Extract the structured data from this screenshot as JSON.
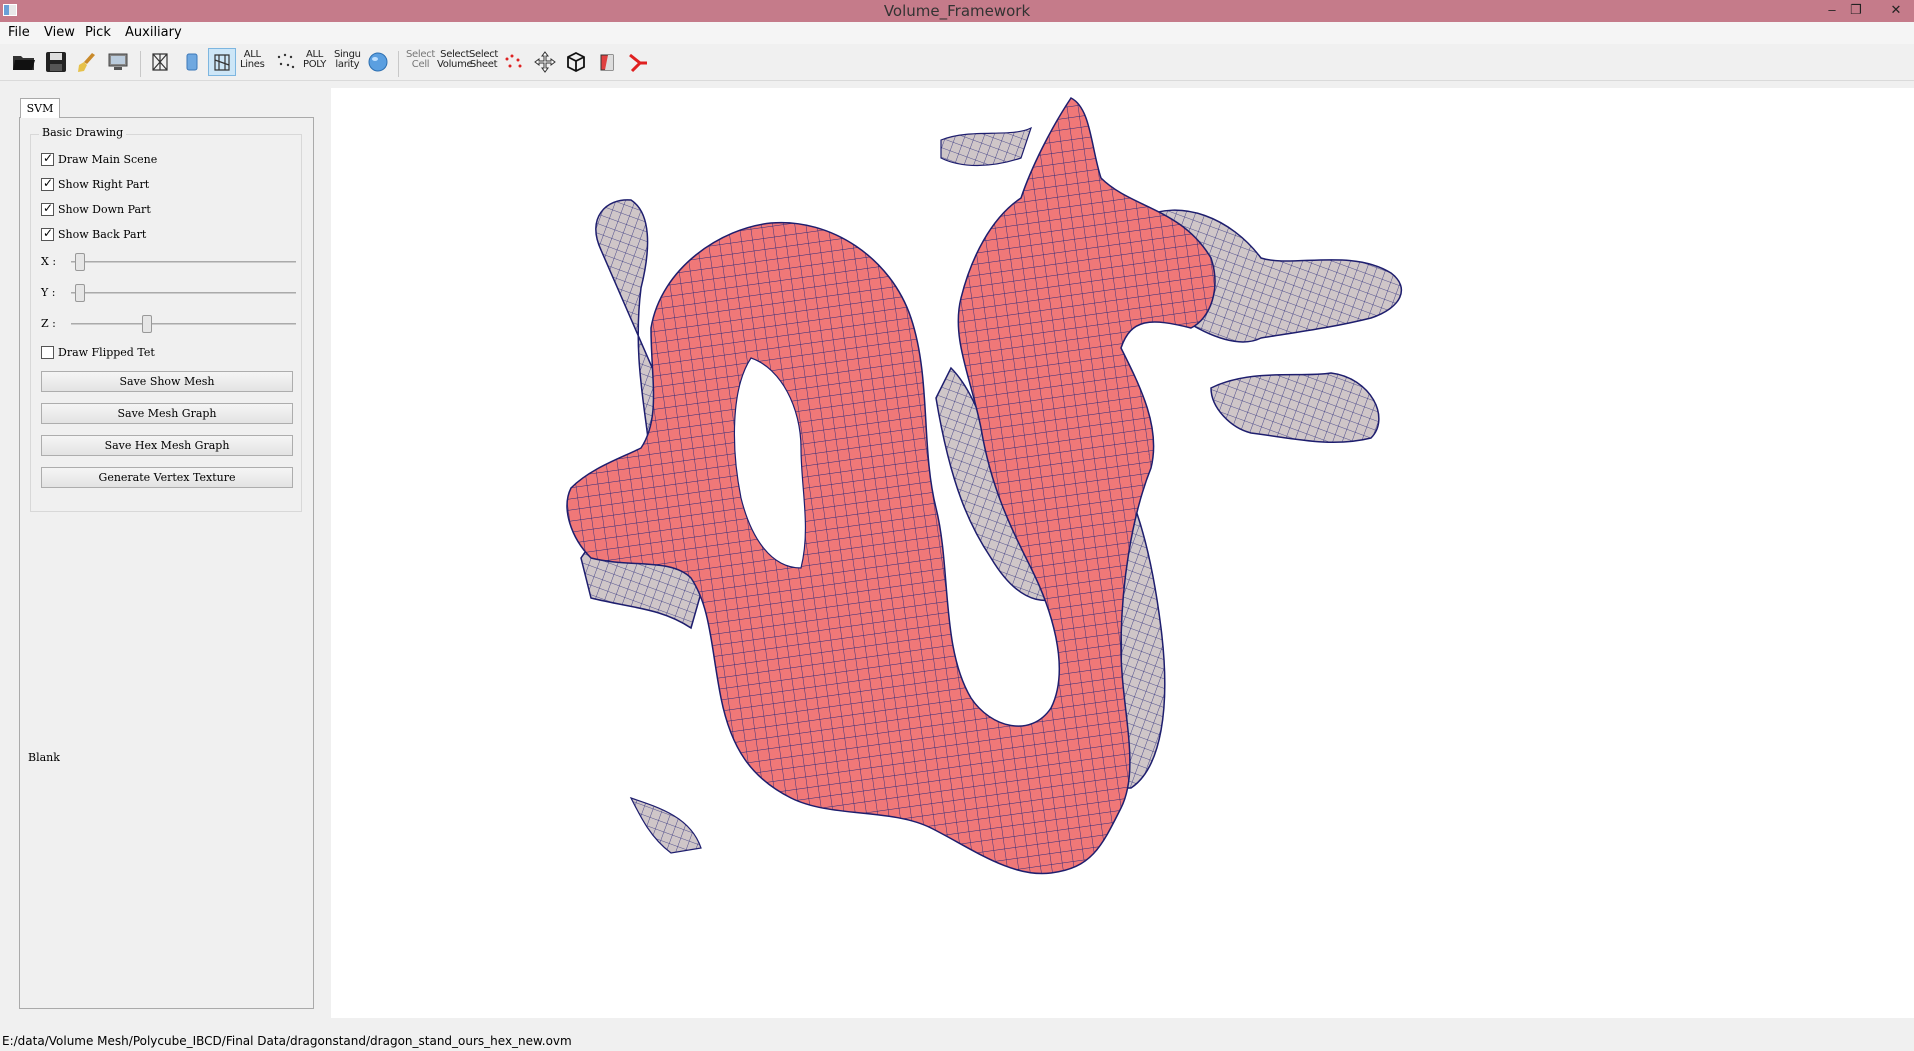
{
  "window": {
    "title": "Volume_Framework",
    "minimize_glyph": "–",
    "restore_glyph": "❐",
    "close_glyph": "✕"
  },
  "menu": [
    "File",
    "View",
    "Pick",
    "Auxiliary"
  ],
  "toolbar": {
    "all_lines": [
      "ALL",
      "Lines"
    ],
    "all_poly": [
      "ALL",
      "POLY"
    ],
    "singularity": [
      "Singu",
      "larity"
    ],
    "select_cell": [
      "Select",
      "Cell"
    ],
    "select_volume": [
      "Select",
      "Volume"
    ],
    "select_sheet": [
      "Select",
      "Sheet"
    ]
  },
  "panel": {
    "tab_label": "SVM",
    "group_title": "Basic Drawing",
    "checkboxes": [
      {
        "label": "Draw Main Scene",
        "checked": true
      },
      {
        "label": "Show Right Part",
        "checked": true
      },
      {
        "label": "Show Down Part",
        "checked": true
      },
      {
        "label": "Show Back Part",
        "checked": true
      }
    ],
    "sliders": [
      {
        "label": "X :",
        "value": 0.02
      },
      {
        "label": "Y :",
        "value": 0.02
      },
      {
        "label": "Z :",
        "value": 0.33
      }
    ],
    "flipped_checkbox": {
      "label": "Draw Flipped Tet",
      "checked": false
    },
    "buttons": [
      "Save Show Mesh",
      "Save Mesh Graph",
      "Save Hex Mesh Graph",
      "Generate Vertex Texture"
    ],
    "blank_label": "Blank"
  },
  "status": {
    "path": "E:/data/Volume Mesh/Polycube_IBCD/Final Data/dragonstand/dragon_stand_ours_hex_new.ovm"
  },
  "colors": {
    "titlebar": "#c57b8a",
    "mesh_surface": "#f07878",
    "mesh_interior": "#cfc6c8",
    "mesh_edges": "#2a2a7a"
  }
}
